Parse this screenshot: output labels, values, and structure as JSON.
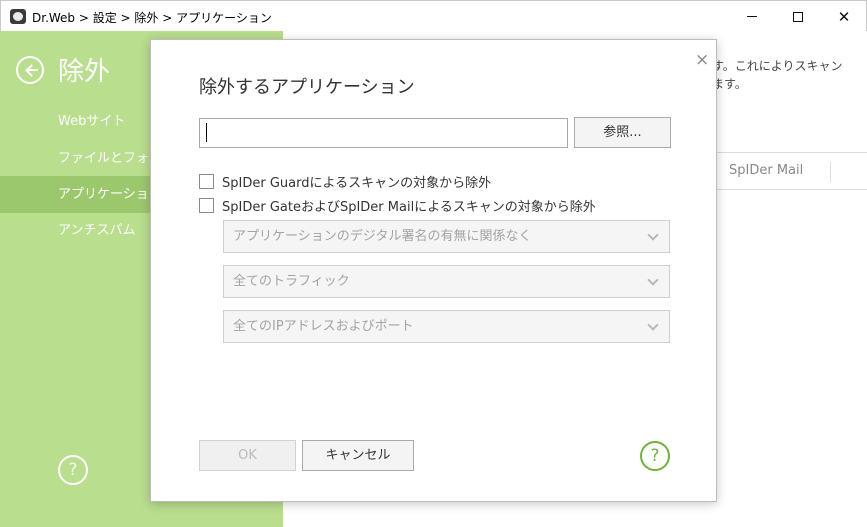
{
  "window": {
    "title": "Dr.Web > 設定 > 除外 > アプリケーション",
    "minimize_icon": "minimize-icon",
    "maximize_icon": "maximize-icon",
    "close_glyph": "✕"
  },
  "sidebar": {
    "title": "除外",
    "items": [
      {
        "label": "Webサイト"
      },
      {
        "label": "ファイルとフォルダ"
      },
      {
        "label": "アプリケーション"
      },
      {
        "label": "アンチスパム"
      }
    ],
    "active_index": 2,
    "help_glyph": "?"
  },
  "main": {
    "description": "す。これによりスキャン\nます。",
    "tab_label": "SpIDer Mail"
  },
  "modal": {
    "title": "除外するアプリケーション",
    "close_glyph": "×",
    "path_input": {
      "value": "",
      "placeholder": ""
    },
    "browse_label": "参照...",
    "checkbox_guard_label": "SpIDer Guardによるスキャンの対象から除外",
    "checkbox_gate_label": "SpIDer GateおよびSpIDer Mailによるスキャンの対象から除外",
    "dropdown_signature": "アプリケーションのデジタル署名の有無に関係なく",
    "dropdown_traffic": "全てのトラフィック",
    "dropdown_ip": "全てのIPアドレスおよびポート",
    "ok_label": "OK",
    "cancel_label": "キャンセル",
    "help_glyph": "?"
  },
  "colors": {
    "sidebar_bg": "#b9de8d",
    "sidebar_active": "#9cc86d",
    "accent_green": "#6fb33b"
  }
}
